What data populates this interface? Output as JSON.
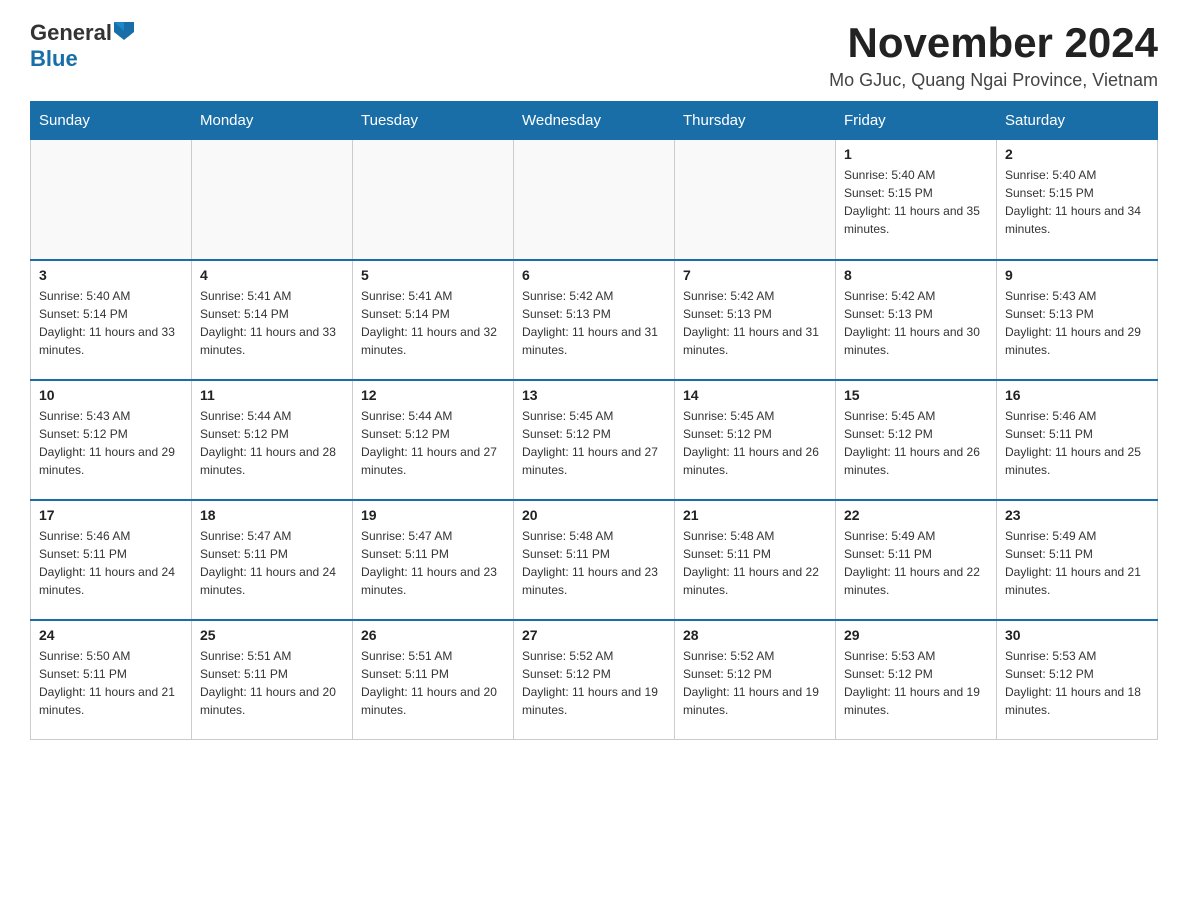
{
  "header": {
    "logo_general": "General",
    "logo_blue": "Blue",
    "title": "November 2024",
    "subtitle": "Mo GJuc, Quang Ngai Province, Vietnam"
  },
  "days_of_week": [
    "Sunday",
    "Monday",
    "Tuesday",
    "Wednesday",
    "Thursday",
    "Friday",
    "Saturday"
  ],
  "weeks": [
    [
      {
        "day": "",
        "sunrise": "",
        "sunset": "",
        "daylight": ""
      },
      {
        "day": "",
        "sunrise": "",
        "sunset": "",
        "daylight": ""
      },
      {
        "day": "",
        "sunrise": "",
        "sunset": "",
        "daylight": ""
      },
      {
        "day": "",
        "sunrise": "",
        "sunset": "",
        "daylight": ""
      },
      {
        "day": "",
        "sunrise": "",
        "sunset": "",
        "daylight": ""
      },
      {
        "day": "1",
        "sunrise": "Sunrise: 5:40 AM",
        "sunset": "Sunset: 5:15 PM",
        "daylight": "Daylight: 11 hours and 35 minutes."
      },
      {
        "day": "2",
        "sunrise": "Sunrise: 5:40 AM",
        "sunset": "Sunset: 5:15 PM",
        "daylight": "Daylight: 11 hours and 34 minutes."
      }
    ],
    [
      {
        "day": "3",
        "sunrise": "Sunrise: 5:40 AM",
        "sunset": "Sunset: 5:14 PM",
        "daylight": "Daylight: 11 hours and 33 minutes."
      },
      {
        "day": "4",
        "sunrise": "Sunrise: 5:41 AM",
        "sunset": "Sunset: 5:14 PM",
        "daylight": "Daylight: 11 hours and 33 minutes."
      },
      {
        "day": "5",
        "sunrise": "Sunrise: 5:41 AM",
        "sunset": "Sunset: 5:14 PM",
        "daylight": "Daylight: 11 hours and 32 minutes."
      },
      {
        "day": "6",
        "sunrise": "Sunrise: 5:42 AM",
        "sunset": "Sunset: 5:13 PM",
        "daylight": "Daylight: 11 hours and 31 minutes."
      },
      {
        "day": "7",
        "sunrise": "Sunrise: 5:42 AM",
        "sunset": "Sunset: 5:13 PM",
        "daylight": "Daylight: 11 hours and 31 minutes."
      },
      {
        "day": "8",
        "sunrise": "Sunrise: 5:42 AM",
        "sunset": "Sunset: 5:13 PM",
        "daylight": "Daylight: 11 hours and 30 minutes."
      },
      {
        "day": "9",
        "sunrise": "Sunrise: 5:43 AM",
        "sunset": "Sunset: 5:13 PM",
        "daylight": "Daylight: 11 hours and 29 minutes."
      }
    ],
    [
      {
        "day": "10",
        "sunrise": "Sunrise: 5:43 AM",
        "sunset": "Sunset: 5:12 PM",
        "daylight": "Daylight: 11 hours and 29 minutes."
      },
      {
        "day": "11",
        "sunrise": "Sunrise: 5:44 AM",
        "sunset": "Sunset: 5:12 PM",
        "daylight": "Daylight: 11 hours and 28 minutes."
      },
      {
        "day": "12",
        "sunrise": "Sunrise: 5:44 AM",
        "sunset": "Sunset: 5:12 PM",
        "daylight": "Daylight: 11 hours and 27 minutes."
      },
      {
        "day": "13",
        "sunrise": "Sunrise: 5:45 AM",
        "sunset": "Sunset: 5:12 PM",
        "daylight": "Daylight: 11 hours and 27 minutes."
      },
      {
        "day": "14",
        "sunrise": "Sunrise: 5:45 AM",
        "sunset": "Sunset: 5:12 PM",
        "daylight": "Daylight: 11 hours and 26 minutes."
      },
      {
        "day": "15",
        "sunrise": "Sunrise: 5:45 AM",
        "sunset": "Sunset: 5:12 PM",
        "daylight": "Daylight: 11 hours and 26 minutes."
      },
      {
        "day": "16",
        "sunrise": "Sunrise: 5:46 AM",
        "sunset": "Sunset: 5:11 PM",
        "daylight": "Daylight: 11 hours and 25 minutes."
      }
    ],
    [
      {
        "day": "17",
        "sunrise": "Sunrise: 5:46 AM",
        "sunset": "Sunset: 5:11 PM",
        "daylight": "Daylight: 11 hours and 24 minutes."
      },
      {
        "day": "18",
        "sunrise": "Sunrise: 5:47 AM",
        "sunset": "Sunset: 5:11 PM",
        "daylight": "Daylight: 11 hours and 24 minutes."
      },
      {
        "day": "19",
        "sunrise": "Sunrise: 5:47 AM",
        "sunset": "Sunset: 5:11 PM",
        "daylight": "Daylight: 11 hours and 23 minutes."
      },
      {
        "day": "20",
        "sunrise": "Sunrise: 5:48 AM",
        "sunset": "Sunset: 5:11 PM",
        "daylight": "Daylight: 11 hours and 23 minutes."
      },
      {
        "day": "21",
        "sunrise": "Sunrise: 5:48 AM",
        "sunset": "Sunset: 5:11 PM",
        "daylight": "Daylight: 11 hours and 22 minutes."
      },
      {
        "day": "22",
        "sunrise": "Sunrise: 5:49 AM",
        "sunset": "Sunset: 5:11 PM",
        "daylight": "Daylight: 11 hours and 22 minutes."
      },
      {
        "day": "23",
        "sunrise": "Sunrise: 5:49 AM",
        "sunset": "Sunset: 5:11 PM",
        "daylight": "Daylight: 11 hours and 21 minutes."
      }
    ],
    [
      {
        "day": "24",
        "sunrise": "Sunrise: 5:50 AM",
        "sunset": "Sunset: 5:11 PM",
        "daylight": "Daylight: 11 hours and 21 minutes."
      },
      {
        "day": "25",
        "sunrise": "Sunrise: 5:51 AM",
        "sunset": "Sunset: 5:11 PM",
        "daylight": "Daylight: 11 hours and 20 minutes."
      },
      {
        "day": "26",
        "sunrise": "Sunrise: 5:51 AM",
        "sunset": "Sunset: 5:11 PM",
        "daylight": "Daylight: 11 hours and 20 minutes."
      },
      {
        "day": "27",
        "sunrise": "Sunrise: 5:52 AM",
        "sunset": "Sunset: 5:12 PM",
        "daylight": "Daylight: 11 hours and 19 minutes."
      },
      {
        "day": "28",
        "sunrise": "Sunrise: 5:52 AM",
        "sunset": "Sunset: 5:12 PM",
        "daylight": "Daylight: 11 hours and 19 minutes."
      },
      {
        "day": "29",
        "sunrise": "Sunrise: 5:53 AM",
        "sunset": "Sunset: 5:12 PM",
        "daylight": "Daylight: 11 hours and 19 minutes."
      },
      {
        "day": "30",
        "sunrise": "Sunrise: 5:53 AM",
        "sunset": "Sunset: 5:12 PM",
        "daylight": "Daylight: 11 hours and 18 minutes."
      }
    ]
  ]
}
